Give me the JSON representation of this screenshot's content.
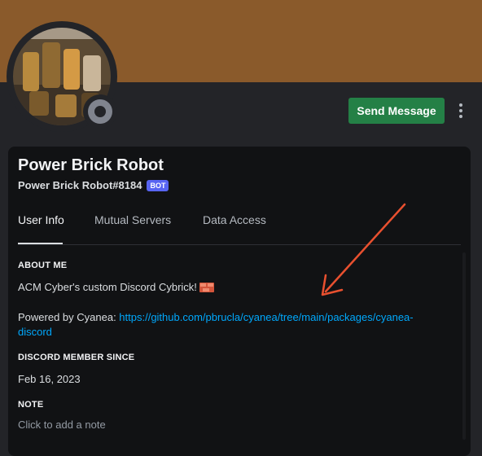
{
  "profile": {
    "display_name": "Power Brick Robot",
    "username_tag": "Power Brick Robot#8184",
    "bot_badge": "BOT",
    "status": "offline",
    "avatar_icon": "avatar-image"
  },
  "header": {
    "send_message_label": "Send Message",
    "more_icon": "more-vertical-icon",
    "banner_color": "#8a5a2b"
  },
  "tabs": [
    {
      "label": "User Info",
      "active": true
    },
    {
      "label": "Mutual Servers",
      "active": false
    },
    {
      "label": "Data Access",
      "active": false
    }
  ],
  "about_me": {
    "title": "ABOUT ME",
    "description": "ACM Cyber's custom Discord Cybrick!",
    "emoji_icon": "brick-icon",
    "powered_by_prefix": "Powered by Cyanea: ",
    "powered_by_link_line1": "https://github.com/pbrucla/cyanea/tree/main/packages/cyanea-",
    "powered_by_link_line2": "discord"
  },
  "member_since": {
    "title": "DISCORD MEMBER SINCE",
    "date": "Feb 16, 2023"
  },
  "note": {
    "title": "NOTE",
    "placeholder": "Click to add a note"
  },
  "colors": {
    "accent_green": "#248046",
    "link_blue": "#00a8fc",
    "badge_blurple": "#5865f2",
    "arrow_red": "#e8502f"
  }
}
